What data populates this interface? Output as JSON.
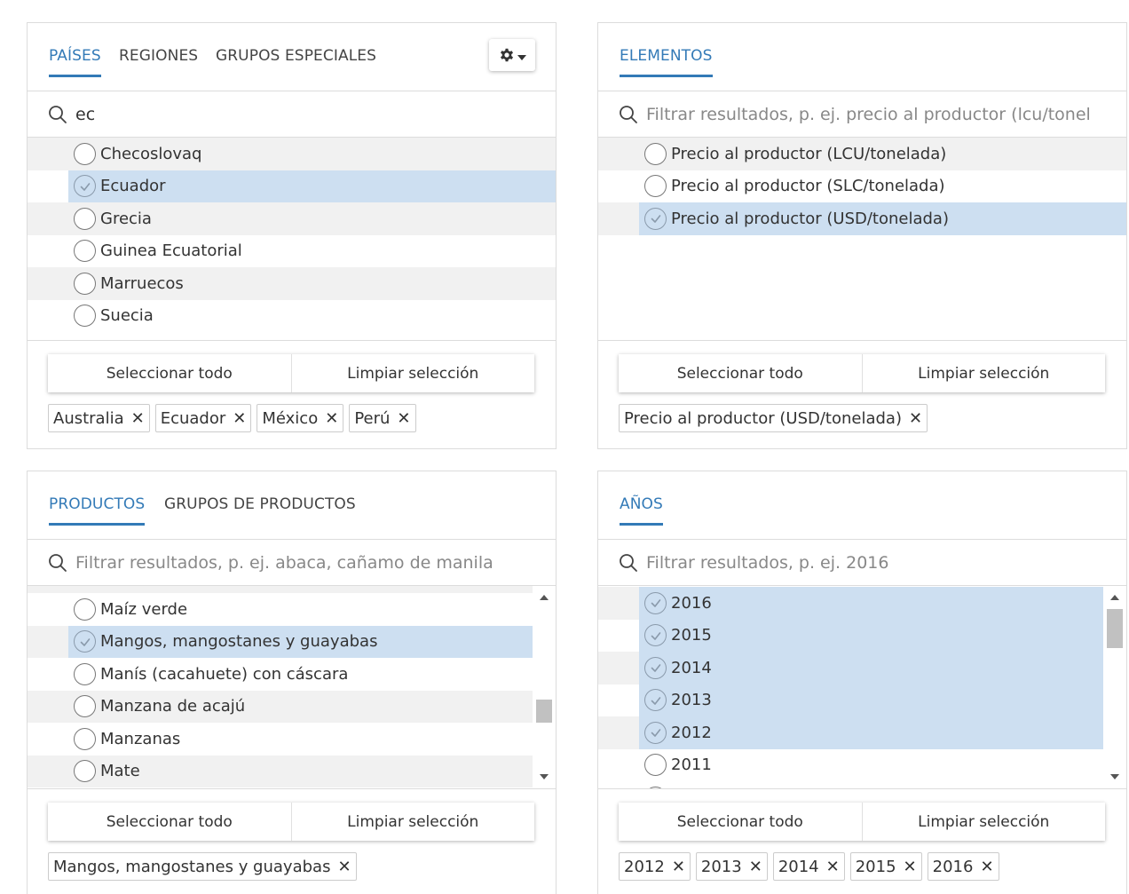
{
  "countries_panel": {
    "tabs": [
      "PAÍSES",
      "REGIONES",
      "GRUPOS ESPECIALES"
    ],
    "search_value": "ec",
    "search_placeholder": "",
    "items": [
      {
        "label": "Checoslovaq",
        "selected": false
      },
      {
        "label": "Ecuador",
        "selected": true
      },
      {
        "label": "Grecia",
        "selected": false
      },
      {
        "label": "Guinea Ecuatorial",
        "selected": false
      },
      {
        "label": "Marruecos",
        "selected": false
      },
      {
        "label": "Suecia",
        "selected": false
      }
    ],
    "select_all": "Seleccionar todo",
    "clear_selection": "Limpiar selección",
    "chips": [
      "Australia",
      "Ecuador",
      "México",
      "Perú"
    ]
  },
  "elements_panel": {
    "tabs": [
      "ELEMENTOS"
    ],
    "search_placeholder": "Filtrar resultados, p. ej. precio al productor (lcu/tonel",
    "items": [
      {
        "label": "Precio al productor (LCU/tonelada)",
        "selected": false
      },
      {
        "label": "Precio al productor (SLC/tonelada)",
        "selected": false
      },
      {
        "label": "Precio al productor (USD/tonelada)",
        "selected": true
      }
    ],
    "select_all": "Seleccionar todo",
    "clear_selection": "Limpiar selección",
    "chips": [
      "Precio al productor (USD/tonelada)"
    ]
  },
  "products_panel": {
    "tabs": [
      "PRODUCTOS",
      "GRUPOS DE PRODUCTOS"
    ],
    "search_placeholder": "Filtrar resultados, p. ej. abaca, cañamo de manila",
    "items": [
      {
        "label": "Maíz verde",
        "selected": false
      },
      {
        "label": "Mangos, mangostanes y guayabas",
        "selected": true
      },
      {
        "label": "Manís (cacahuete) con cáscara",
        "selected": false
      },
      {
        "label": "Manzana de acajú",
        "selected": false
      },
      {
        "label": "Manzanas",
        "selected": false
      },
      {
        "label": "Mate",
        "selected": false
      }
    ],
    "select_all": "Seleccionar todo",
    "clear_selection": "Limpiar selección",
    "chips": [
      "Mangos, mangostanes y guayabas"
    ]
  },
  "years_panel": {
    "tabs": [
      "AÑOS"
    ],
    "search_placeholder": "Filtrar resultados, p. ej. 2016",
    "items": [
      {
        "label": "2016",
        "selected": true
      },
      {
        "label": "2015",
        "selected": true
      },
      {
        "label": "2014",
        "selected": true
      },
      {
        "label": "2013",
        "selected": true
      },
      {
        "label": "2012",
        "selected": true
      },
      {
        "label": "2011",
        "selected": false
      }
    ],
    "select_all": "Seleccionar todo",
    "clear_selection": "Limpiar selección",
    "chips": [
      "2012",
      "2013",
      "2014",
      "2015",
      "2016"
    ]
  },
  "icons": {
    "search": "search-icon",
    "settings": "gear-icon",
    "dropdown": "caret-down-icon",
    "remove": "close-icon",
    "selected": "check-circle-icon"
  },
  "colors": {
    "accent": "#337ab7",
    "selected_row": "#cddff1",
    "alt_row": "#f1f1f1"
  }
}
